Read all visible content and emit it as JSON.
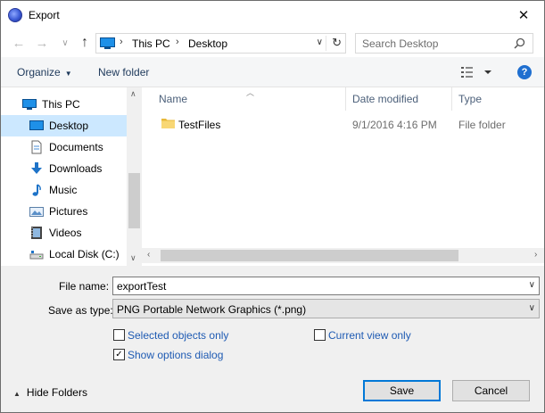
{
  "window": {
    "title": "Export",
    "close_label": "✕"
  },
  "nav": {
    "back_icon": "arrow-left-icon",
    "forward_icon": "arrow-right-icon",
    "recent_icon": "chevron-down-icon",
    "up_icon": "arrow-up-icon",
    "breadcrumbs": [
      "This PC",
      "Desktop"
    ],
    "search_placeholder": "Search Desktop"
  },
  "toolbar": {
    "organize_label": "Organize",
    "new_folder_label": "New folder",
    "help_label": "?"
  },
  "sidebar": {
    "items": [
      {
        "label": "This PC",
        "icon": "computer-icon"
      },
      {
        "label": "Desktop",
        "icon": "desktop-icon",
        "selected": true
      },
      {
        "label": "Documents",
        "icon": "documents-icon"
      },
      {
        "label": "Downloads",
        "icon": "download-icon"
      },
      {
        "label": "Music",
        "icon": "music-icon"
      },
      {
        "label": "Pictures",
        "icon": "pictures-icon"
      },
      {
        "label": "Videos",
        "icon": "videos-icon"
      },
      {
        "label": "Local Disk (C:)",
        "icon": "drive-icon"
      }
    ]
  },
  "file_list": {
    "columns": [
      "Name",
      "Date modified",
      "Type"
    ],
    "rows": [
      {
        "name": "TestFiles",
        "date": "9/1/2016 4:16 PM",
        "type": "File folder",
        "icon": "folder-icon"
      }
    ]
  },
  "form": {
    "filename_label": "File name:",
    "filename_value": "exportTest",
    "savetype_label": "Save as type:",
    "savetype_value": "PNG Portable Network Graphics (*.png)",
    "options": {
      "selected_only": {
        "label": "Selected objects only",
        "checked": false
      },
      "current_view": {
        "label": "Current view only",
        "checked": false
      },
      "show_options": {
        "label": "Show options dialog",
        "checked": true
      }
    }
  },
  "footer": {
    "hide_folders_label": "Hide Folders",
    "save_label": "Save",
    "cancel_label": "Cancel"
  },
  "colors": {
    "accent": "#0078d7",
    "selection": "#cce8ff",
    "link": "#1f5bb3"
  }
}
